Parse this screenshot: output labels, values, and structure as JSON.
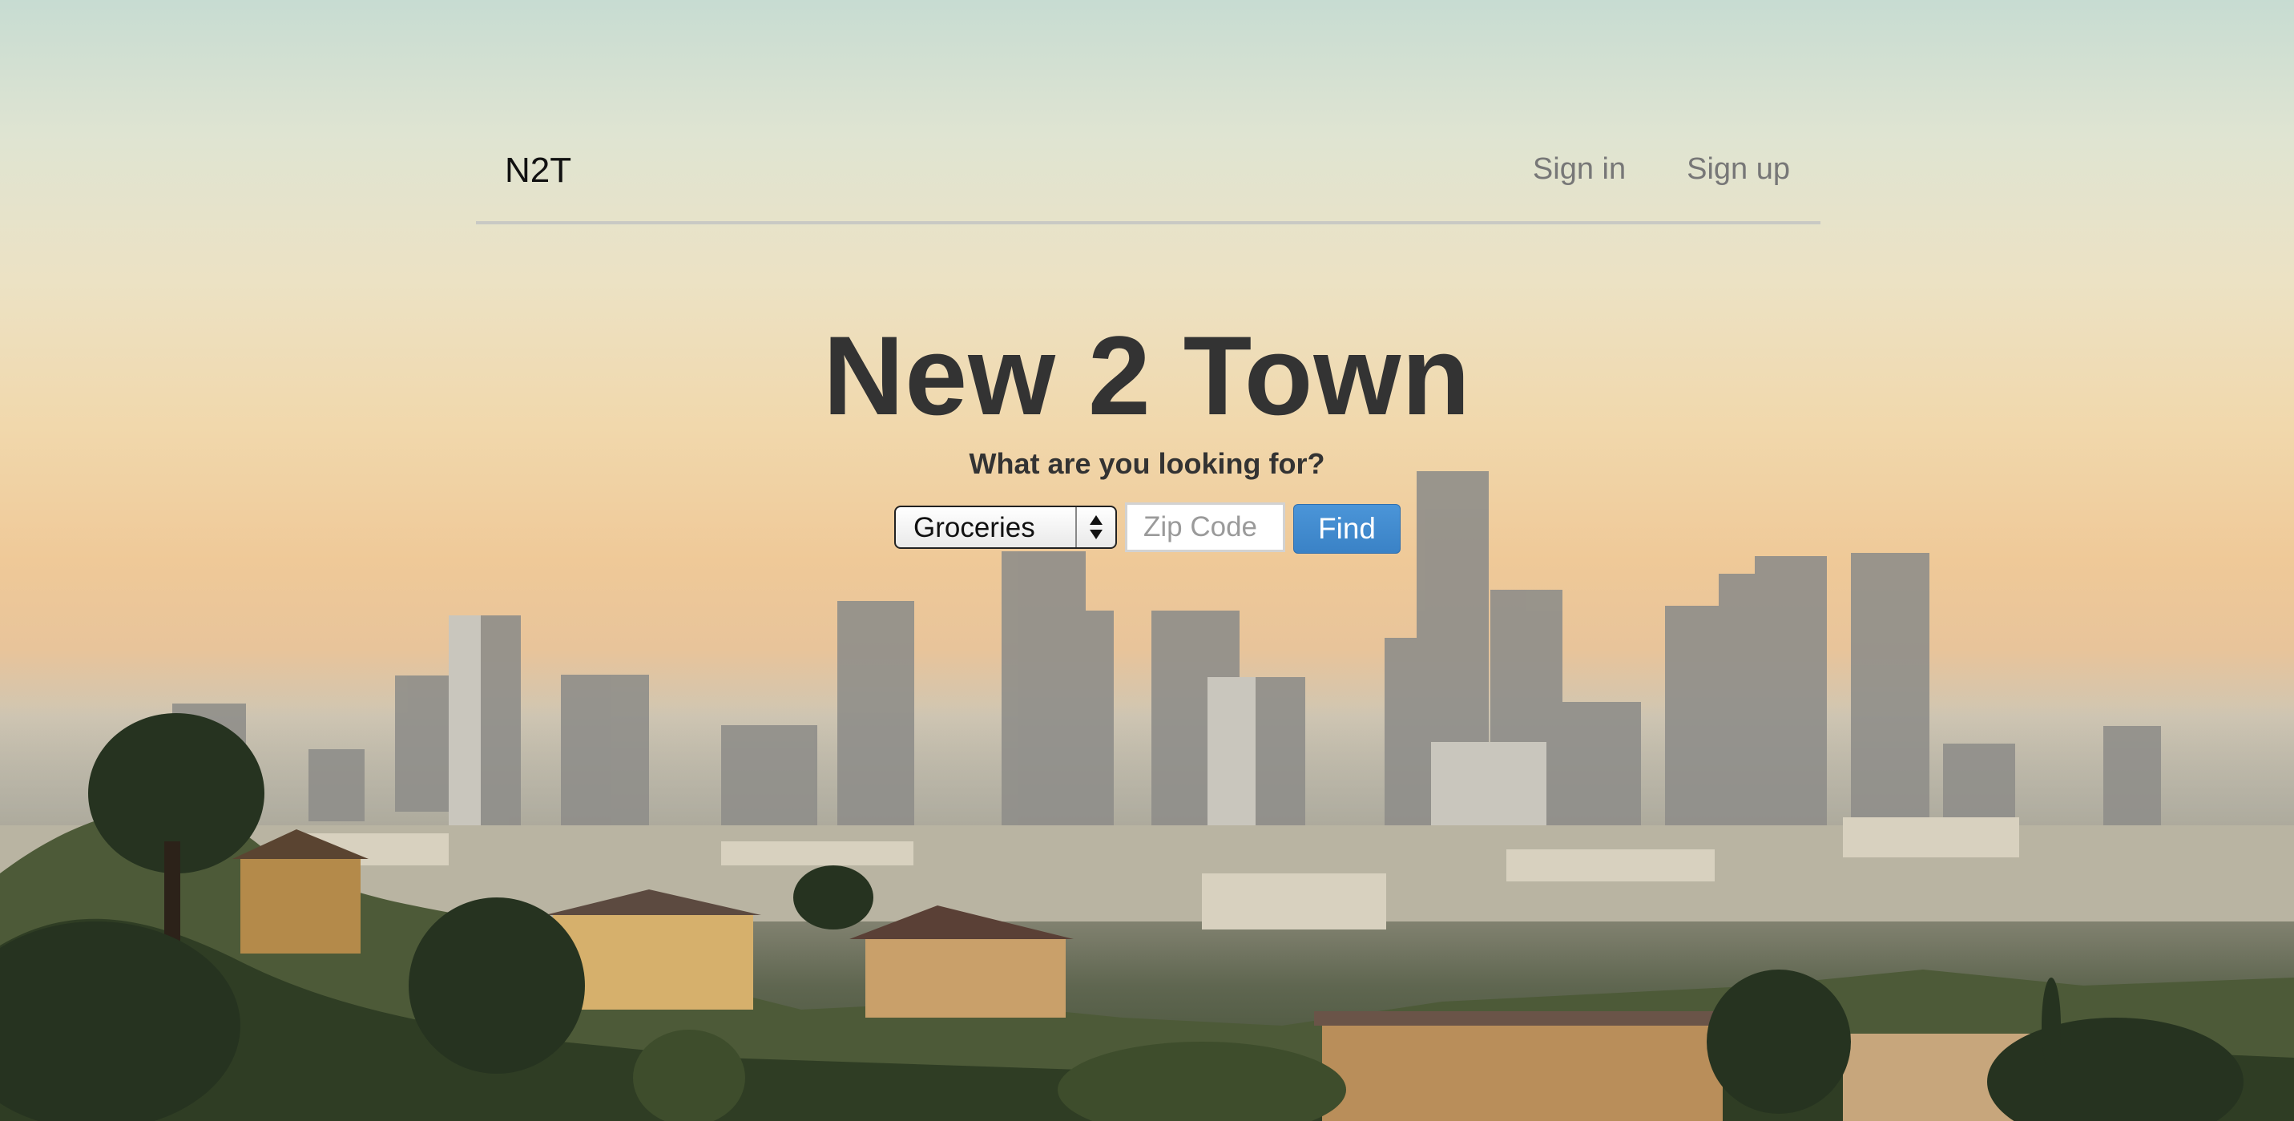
{
  "navbar": {
    "brand": "N2T",
    "links": [
      "Sign in",
      "Sign up"
    ]
  },
  "hero": {
    "title": "New 2 Town",
    "subtitle": "What are you looking for?"
  },
  "search": {
    "category_selected": "Groceries",
    "zip_placeholder": "Zip Code",
    "zip_value": "",
    "find_label": "Find"
  },
  "colors": {
    "accent": "#3a87cc",
    "title_text": "#333333",
    "nav_link": "#777777"
  }
}
